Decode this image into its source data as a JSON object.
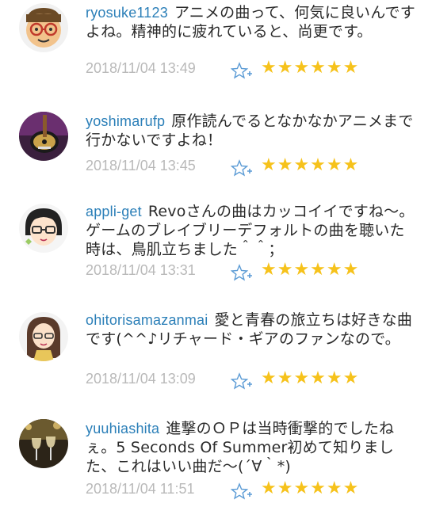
{
  "comments": [
    {
      "username": "ryosuke1123",
      "text": "アニメの曲って、何気に良いんですよね。精神的に疲れていると、尚更です。",
      "timestamp": "2018/11/04 13:49",
      "rating": 6,
      "avatar_icon": "glasses-face-avatar-icon"
    },
    {
      "username": "yoshimarufp",
      "text": "原作読んでるとなかなかアニメまで行かないですよね！",
      "timestamp": "2018/11/04 13:45",
      "rating": 6,
      "avatar_icon": "guitar-photo-avatar-icon"
    },
    {
      "username": "appli-get",
      "text": "Revoさんの曲はカッコイイですね〜。ゲームのブレイブリーデフォルトの曲を聴いた時は、鳥肌立ちました＾＾；",
      "timestamp": "2018/11/04 13:31",
      "rating": 6,
      "avatar_icon": "glasses-person-avatar-icon"
    },
    {
      "username": "ohitorisamazanmai",
      "text": "愛と青春の旅立ちは好きな曲です(^^♪リチャード・ギアのファンなので。",
      "timestamp": "2018/11/04 13:09",
      "rating": 6,
      "avatar_icon": "long-hair-woman-avatar-icon"
    },
    {
      "username": "yuuhiashita",
      "text": "進撃のＯＰは当時衝撃的でしたねぇ。5 Seconds Of Summer初めて知りました、これはいい曲だ〜(´∀｀*)",
      "timestamp": "2018/11/04 11:51",
      "rating": 6,
      "avatar_icon": "wine-glasses-photo-avatar-icon"
    }
  ],
  "icons": {
    "favorite": "star-plus-icon",
    "rating": "star-icon"
  },
  "colors": {
    "username": "#2b7fb8",
    "timestamp": "#b9b9b9",
    "star": "#f6c21b",
    "favorite_outline": "#5b9bd5"
  }
}
